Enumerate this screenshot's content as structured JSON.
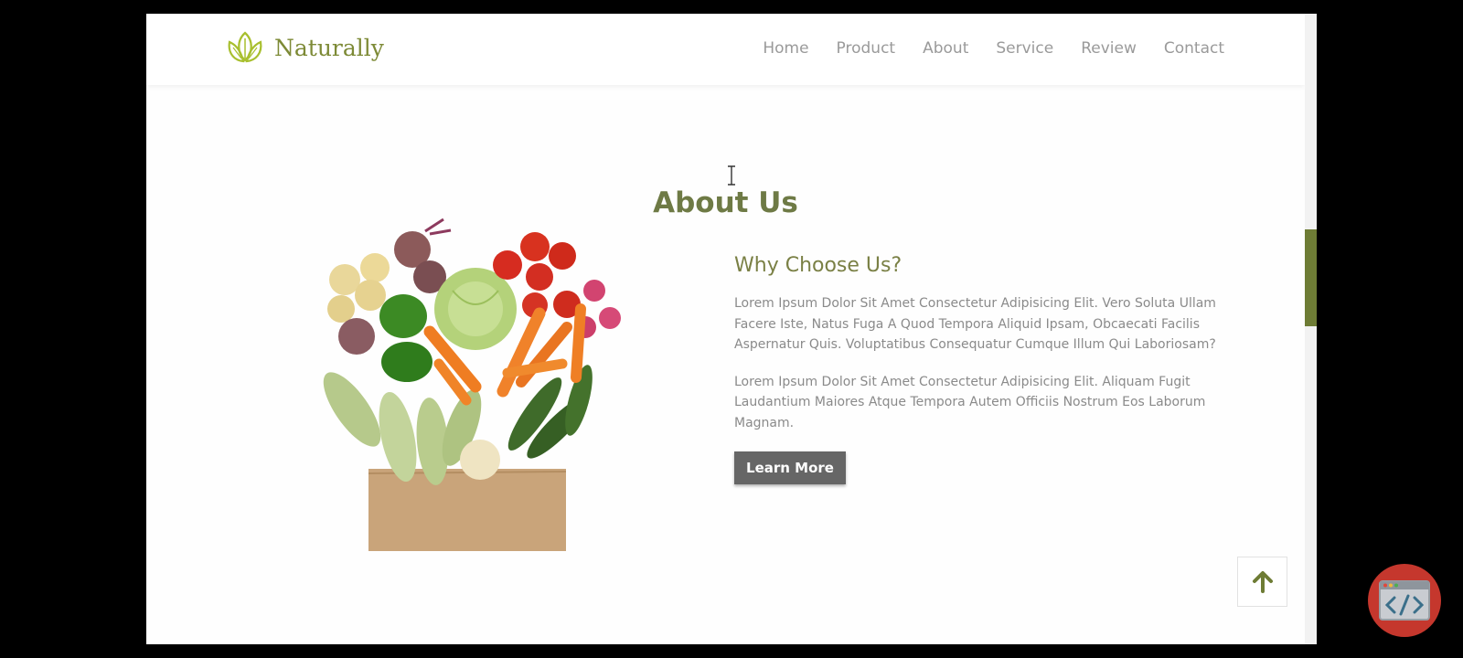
{
  "brand": {
    "name": "Naturally",
    "icon": "leaf-logo-icon",
    "color": "#7d8a36"
  },
  "nav": {
    "items": [
      {
        "label": "Home"
      },
      {
        "label": "Product"
      },
      {
        "label": "About"
      },
      {
        "label": "Service"
      },
      {
        "label": "Review"
      },
      {
        "label": "Contact"
      }
    ]
  },
  "about": {
    "title": "About Us",
    "heading": "Why Choose Us?",
    "paragraphs": [
      "Lorem Ipsum Dolor Sit Amet Consectetur Adipisicing Elit. Vero Soluta Ullam Facere Iste, Natus Fuga A Quod Tempora Aliquid Ipsam, Obcaecati Facilis Aspernatur Quis. Voluptatibus Consequatur Cumque Illum Qui Laboriosam?",
      "Lorem Ipsum Dolor Sit Amet Consectetur Adipisicing Elit. Aliquam Fugit Laudantium Maiores Atque Tempora Autem Officiis Nostrum Eos Laborum Magnam."
    ],
    "button_label": "Learn More",
    "image": "vegetables-in-paper-bag"
  },
  "scroll_top": {
    "icon": "arrow-up-icon"
  },
  "badge": {
    "icon": "code-icon"
  },
  "colors": {
    "accent": "#6e7c35",
    "button": "#666666",
    "badge": "#c5372d"
  }
}
